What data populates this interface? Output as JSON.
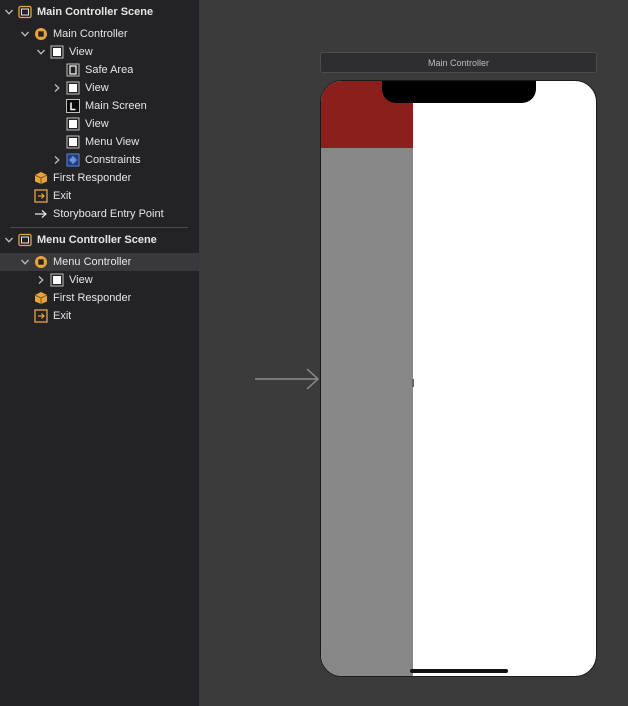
{
  "outline": {
    "rows": [
      {
        "label": "Main Controller Scene",
        "indent": 0,
        "disclosure": "open",
        "icon": "scene-icon",
        "bold": true
      },
      {
        "label": "Main Controller",
        "indent": 1,
        "disclosure": "open",
        "icon": "view-controller-icon"
      },
      {
        "label": "View",
        "indent": 2,
        "disclosure": "open",
        "icon": "view-icon"
      },
      {
        "label": "Safe Area",
        "indent": 3,
        "disclosure": "none",
        "icon": "safe-area-icon"
      },
      {
        "label": "View",
        "indent": 3,
        "disclosure": "closed",
        "icon": "view-icon"
      },
      {
        "label": "Main Screen",
        "indent": 3,
        "disclosure": "none",
        "icon": "label-icon"
      },
      {
        "label": "View",
        "indent": 3,
        "disclosure": "none",
        "icon": "view-icon"
      },
      {
        "label": "Menu View",
        "indent": 3,
        "disclosure": "none",
        "icon": "view-icon"
      },
      {
        "label": "Constraints",
        "indent": 3,
        "disclosure": "closed",
        "icon": "constraints-icon"
      },
      {
        "label": "First Responder",
        "indent": 1,
        "disclosure": "none",
        "icon": "first-responder-icon"
      },
      {
        "label": "Exit",
        "indent": 1,
        "disclosure": "none",
        "icon": "exit-icon"
      },
      {
        "label": "Storyboard Entry Point",
        "indent": 1,
        "disclosure": "none",
        "icon": "entry-arrow-icon"
      },
      {
        "label": "Menu Controller Scene",
        "indent": 0,
        "disclosure": "open",
        "icon": "scene-icon",
        "bold": true
      },
      {
        "label": "Menu Controller",
        "indent": 1,
        "disclosure": "open",
        "icon": "view-controller-icon",
        "selected": true
      },
      {
        "label": "View",
        "indent": 2,
        "disclosure": "closed",
        "icon": "view-icon"
      },
      {
        "label": "First Responder",
        "indent": 1,
        "disclosure": "none",
        "icon": "first-responder-icon"
      },
      {
        "label": "Exit",
        "indent": 1,
        "disclosure": "none",
        "icon": "exit-icon"
      }
    ]
  },
  "canvas": {
    "scene_title": "Main Controller",
    "colors": {
      "menu_header": "#8a1f1c",
      "menu_panel": "#878787",
      "content": "#ffffff",
      "accent_icon": "#e8a43c"
    }
  }
}
